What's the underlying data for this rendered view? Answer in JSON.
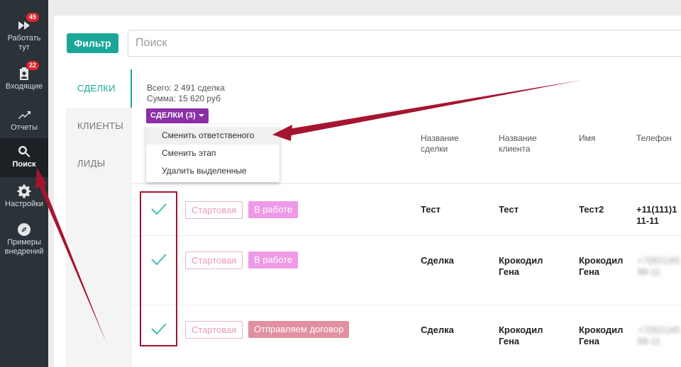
{
  "sidebar": {
    "items": [
      {
        "label_line1": "Работать",
        "label_line2": "тут",
        "badge": "45",
        "icon": "fast-forward-icon"
      },
      {
        "label_line1": "Входящие",
        "label_line2": "",
        "badge": "22",
        "icon": "clipboard-person-icon"
      },
      {
        "label_line1": "Отчеты",
        "label_line2": "",
        "badge": "",
        "icon": "trend-up-icon"
      },
      {
        "label_line1": "Поиск",
        "label_line2": "",
        "badge": "",
        "icon": "search-icon"
      },
      {
        "label_line1": "Настройки",
        "label_line2": "",
        "badge": "",
        "icon": "gear-icon"
      },
      {
        "label_line1": "Примеры",
        "label_line2": "внедрений",
        "badge": "",
        "icon": "compass-icon"
      }
    ]
  },
  "toolbar": {
    "filter_label": "Фильтр",
    "search_placeholder": "Поиск"
  },
  "tabs": [
    {
      "label": "СДЕЛКИ",
      "active": true
    },
    {
      "label": "КЛИЕНТЫ",
      "active": false
    },
    {
      "label": "ЛИДЫ",
      "active": false
    }
  ],
  "summary": {
    "total": "Всего: 2 491 сделка",
    "sum": "Сумма: 15 620 руб"
  },
  "bulk_actions": {
    "button_label": "СДЕЛКИ (3)",
    "menu": [
      "Сменить ответственого",
      "Сменить этап",
      "Удалить выделенные"
    ]
  },
  "columns": {
    "deal_name_1": "Название",
    "deal_name_2": "сделки",
    "client_name_1": "Название",
    "client_name_2": "клиента",
    "name": "Имя",
    "phone": "Телефон"
  },
  "rows": [
    {
      "stage": "Стартовая",
      "status": "В работе",
      "deal": "Тест",
      "client_1": "Тест",
      "client_2": "",
      "name_1": "Тест2",
      "name_2": "",
      "phone_1": "+11(111)1",
      "phone_2": "11-11"
    },
    {
      "stage": "Стартовая",
      "status": "В работе",
      "deal": "Сделка",
      "client_1": "Крокодил",
      "client_2": "Гена",
      "name_1": "Крокодил",
      "name_2": "Гена",
      "phone_1": "+7(921)45",
      "phone_2": "88-11"
    },
    {
      "stage": "Стартовая",
      "status": "Отправляем договор",
      "deal": "Сделка",
      "client_1": "Крокодил",
      "client_2": "Гена",
      "name_1": "Крокодил",
      "name_2": "Гена",
      "phone_1": "+7(921)45",
      "phone_2": "88-11"
    }
  ],
  "colors": {
    "accent": "#1aa79a",
    "bulk": "#8a2fa7",
    "status_in_work": "#ef9ae6",
    "status_contract": "#e0909e",
    "annotation": "#a5152f"
  }
}
